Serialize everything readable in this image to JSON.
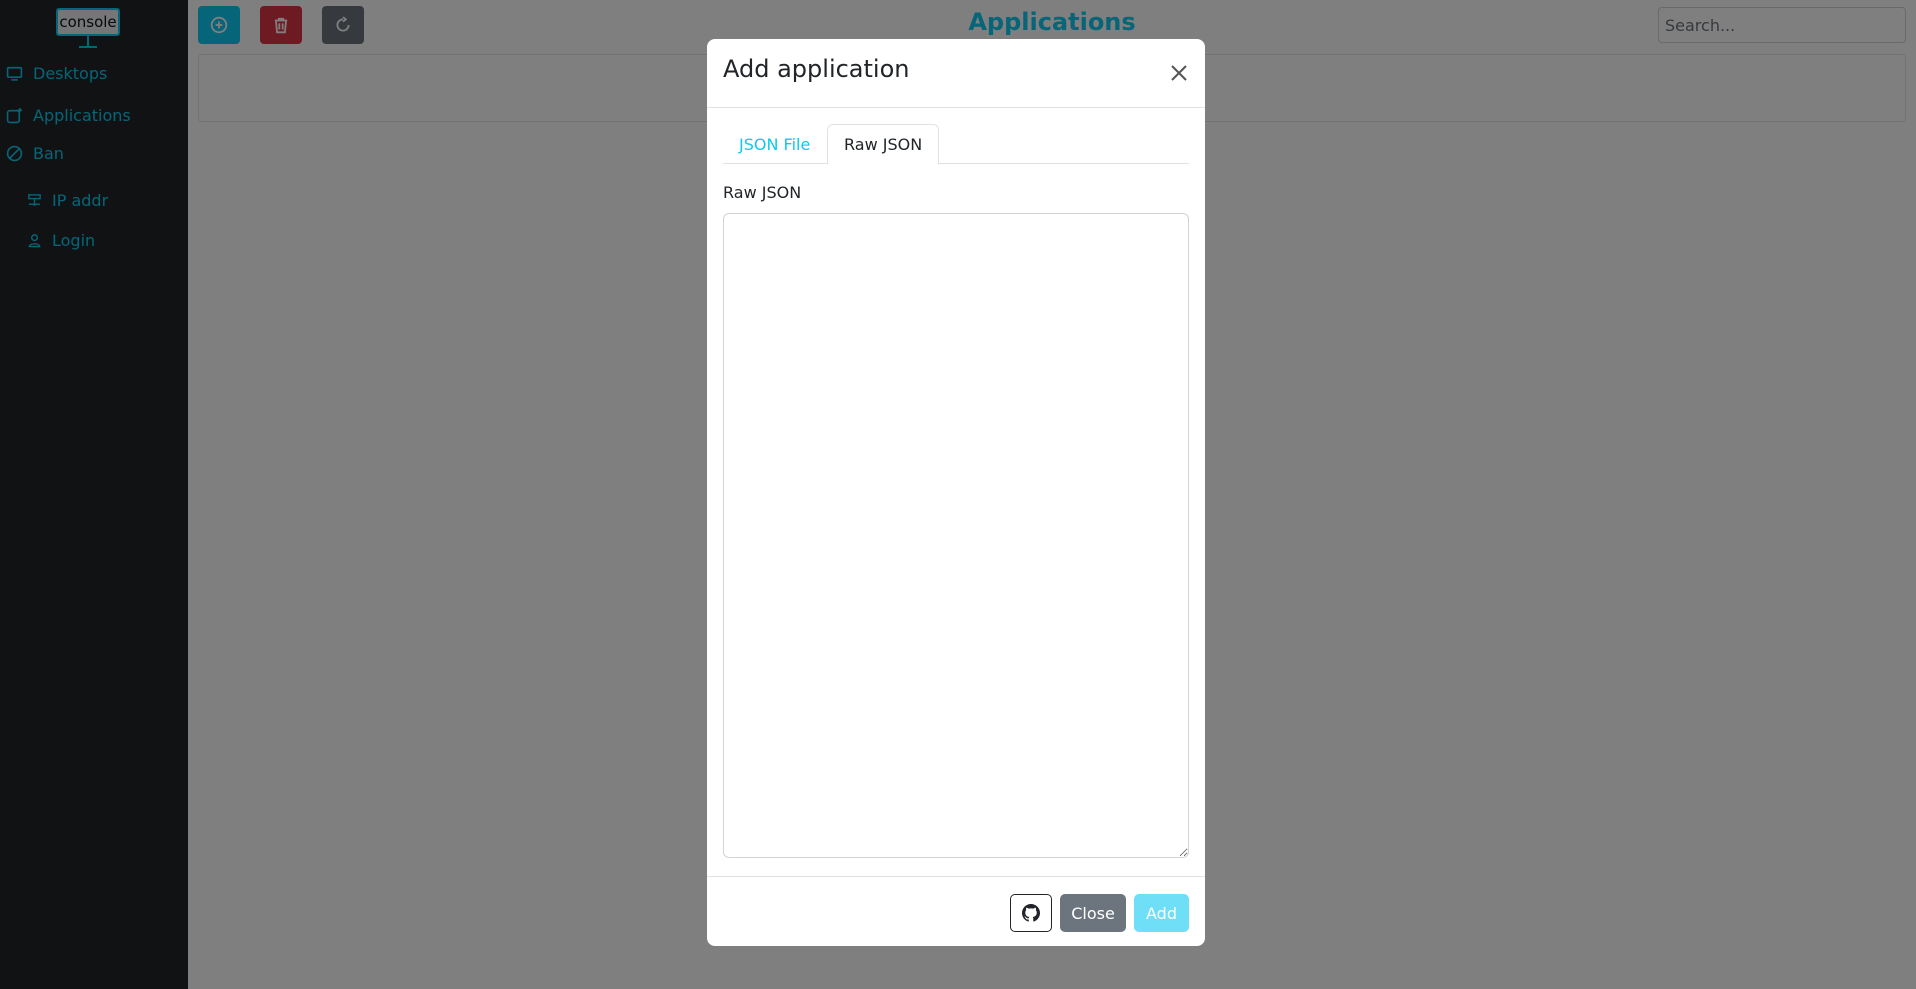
{
  "sidebar": {
    "logo_text": "console",
    "items": [
      {
        "label": "Desktops",
        "icon": "monitor-icon"
      },
      {
        "label": "Applications",
        "icon": "app-plus-icon"
      },
      {
        "label": "Ban",
        "icon": "ban-icon"
      }
    ],
    "sub_items": [
      {
        "label": "IP addr",
        "icon": "network-icon"
      },
      {
        "label": "Login",
        "icon": "person-icon"
      }
    ]
  },
  "toolbar": {
    "add_icon": "plus-circle-icon",
    "delete_icon": "trash-icon",
    "refresh_icon": "refresh-icon",
    "colors": {
      "add": "#0dcaf0",
      "delete": "#dc3545",
      "refresh": "#6c757d"
    }
  },
  "header": {
    "title": "Applications",
    "search_placeholder": "Search..."
  },
  "modal": {
    "title": "Add application",
    "tabs": [
      {
        "label": "JSON File",
        "active": false
      },
      {
        "label": "Raw JSON",
        "active": true
      }
    ],
    "field_label": "Raw JSON",
    "textarea_value": "",
    "footer": {
      "github_icon": "github-icon",
      "close_label": "Close",
      "submit_label": "Add"
    }
  },
  "colors": {
    "accent": "#0dcaf0",
    "sidebar_bg": "#212529"
  }
}
